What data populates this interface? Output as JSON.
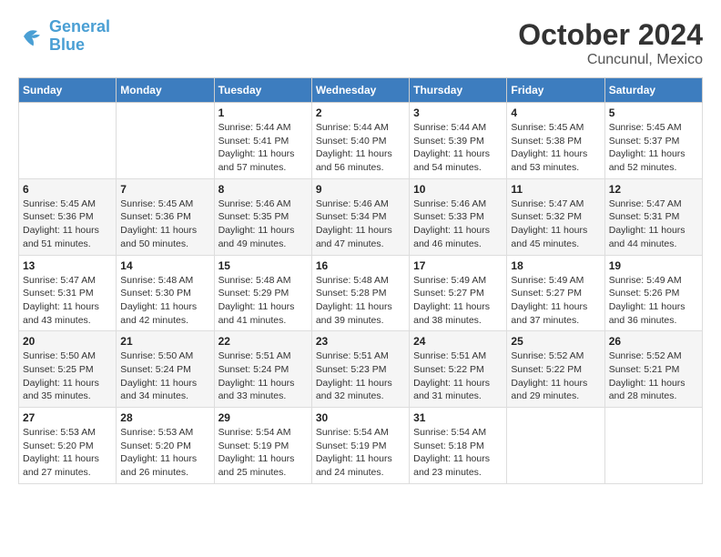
{
  "logo": {
    "line1": "General",
    "line2": "Blue"
  },
  "title": "October 2024",
  "location": "Cuncunul, Mexico",
  "weekdays": [
    "Sunday",
    "Monday",
    "Tuesday",
    "Wednesday",
    "Thursday",
    "Friday",
    "Saturday"
  ],
  "days": [
    {
      "num": "",
      "sunrise": "",
      "sunset": "",
      "daylight": ""
    },
    {
      "num": "",
      "sunrise": "",
      "sunset": "",
      "daylight": ""
    },
    {
      "num": "1",
      "sunrise": "Sunrise: 5:44 AM",
      "sunset": "Sunset: 5:41 PM",
      "daylight": "Daylight: 11 hours and 57 minutes."
    },
    {
      "num": "2",
      "sunrise": "Sunrise: 5:44 AM",
      "sunset": "Sunset: 5:40 PM",
      "daylight": "Daylight: 11 hours and 56 minutes."
    },
    {
      "num": "3",
      "sunrise": "Sunrise: 5:44 AM",
      "sunset": "Sunset: 5:39 PM",
      "daylight": "Daylight: 11 hours and 54 minutes."
    },
    {
      "num": "4",
      "sunrise": "Sunrise: 5:45 AM",
      "sunset": "Sunset: 5:38 PM",
      "daylight": "Daylight: 11 hours and 53 minutes."
    },
    {
      "num": "5",
      "sunrise": "Sunrise: 5:45 AM",
      "sunset": "Sunset: 5:37 PM",
      "daylight": "Daylight: 11 hours and 52 minutes."
    },
    {
      "num": "6",
      "sunrise": "Sunrise: 5:45 AM",
      "sunset": "Sunset: 5:36 PM",
      "daylight": "Daylight: 11 hours and 51 minutes."
    },
    {
      "num": "7",
      "sunrise": "Sunrise: 5:45 AM",
      "sunset": "Sunset: 5:36 PM",
      "daylight": "Daylight: 11 hours and 50 minutes."
    },
    {
      "num": "8",
      "sunrise": "Sunrise: 5:46 AM",
      "sunset": "Sunset: 5:35 PM",
      "daylight": "Daylight: 11 hours and 49 minutes."
    },
    {
      "num": "9",
      "sunrise": "Sunrise: 5:46 AM",
      "sunset": "Sunset: 5:34 PM",
      "daylight": "Daylight: 11 hours and 47 minutes."
    },
    {
      "num": "10",
      "sunrise": "Sunrise: 5:46 AM",
      "sunset": "Sunset: 5:33 PM",
      "daylight": "Daylight: 11 hours and 46 minutes."
    },
    {
      "num": "11",
      "sunrise": "Sunrise: 5:47 AM",
      "sunset": "Sunset: 5:32 PM",
      "daylight": "Daylight: 11 hours and 45 minutes."
    },
    {
      "num": "12",
      "sunrise": "Sunrise: 5:47 AM",
      "sunset": "Sunset: 5:31 PM",
      "daylight": "Daylight: 11 hours and 44 minutes."
    },
    {
      "num": "13",
      "sunrise": "Sunrise: 5:47 AM",
      "sunset": "Sunset: 5:31 PM",
      "daylight": "Daylight: 11 hours and 43 minutes."
    },
    {
      "num": "14",
      "sunrise": "Sunrise: 5:48 AM",
      "sunset": "Sunset: 5:30 PM",
      "daylight": "Daylight: 11 hours and 42 minutes."
    },
    {
      "num": "15",
      "sunrise": "Sunrise: 5:48 AM",
      "sunset": "Sunset: 5:29 PM",
      "daylight": "Daylight: 11 hours and 41 minutes."
    },
    {
      "num": "16",
      "sunrise": "Sunrise: 5:48 AM",
      "sunset": "Sunset: 5:28 PM",
      "daylight": "Daylight: 11 hours and 39 minutes."
    },
    {
      "num": "17",
      "sunrise": "Sunrise: 5:49 AM",
      "sunset": "Sunset: 5:27 PM",
      "daylight": "Daylight: 11 hours and 38 minutes."
    },
    {
      "num": "18",
      "sunrise": "Sunrise: 5:49 AM",
      "sunset": "Sunset: 5:27 PM",
      "daylight": "Daylight: 11 hours and 37 minutes."
    },
    {
      "num": "19",
      "sunrise": "Sunrise: 5:49 AM",
      "sunset": "Sunset: 5:26 PM",
      "daylight": "Daylight: 11 hours and 36 minutes."
    },
    {
      "num": "20",
      "sunrise": "Sunrise: 5:50 AM",
      "sunset": "Sunset: 5:25 PM",
      "daylight": "Daylight: 11 hours and 35 minutes."
    },
    {
      "num": "21",
      "sunrise": "Sunrise: 5:50 AM",
      "sunset": "Sunset: 5:24 PM",
      "daylight": "Daylight: 11 hours and 34 minutes."
    },
    {
      "num": "22",
      "sunrise": "Sunrise: 5:51 AM",
      "sunset": "Sunset: 5:24 PM",
      "daylight": "Daylight: 11 hours and 33 minutes."
    },
    {
      "num": "23",
      "sunrise": "Sunrise: 5:51 AM",
      "sunset": "Sunset: 5:23 PM",
      "daylight": "Daylight: 11 hours and 32 minutes."
    },
    {
      "num": "24",
      "sunrise": "Sunrise: 5:51 AM",
      "sunset": "Sunset: 5:22 PM",
      "daylight": "Daylight: 11 hours and 31 minutes."
    },
    {
      "num": "25",
      "sunrise": "Sunrise: 5:52 AM",
      "sunset": "Sunset: 5:22 PM",
      "daylight": "Daylight: 11 hours and 29 minutes."
    },
    {
      "num": "26",
      "sunrise": "Sunrise: 5:52 AM",
      "sunset": "Sunset: 5:21 PM",
      "daylight": "Daylight: 11 hours and 28 minutes."
    },
    {
      "num": "27",
      "sunrise": "Sunrise: 5:53 AM",
      "sunset": "Sunset: 5:20 PM",
      "daylight": "Daylight: 11 hours and 27 minutes."
    },
    {
      "num": "28",
      "sunrise": "Sunrise: 5:53 AM",
      "sunset": "Sunset: 5:20 PM",
      "daylight": "Daylight: 11 hours and 26 minutes."
    },
    {
      "num": "29",
      "sunrise": "Sunrise: 5:54 AM",
      "sunset": "Sunset: 5:19 PM",
      "daylight": "Daylight: 11 hours and 25 minutes."
    },
    {
      "num": "30",
      "sunrise": "Sunrise: 5:54 AM",
      "sunset": "Sunset: 5:19 PM",
      "daylight": "Daylight: 11 hours and 24 minutes."
    },
    {
      "num": "31",
      "sunrise": "Sunrise: 5:54 AM",
      "sunset": "Sunset: 5:18 PM",
      "daylight": "Daylight: 11 hours and 23 minutes."
    },
    {
      "num": "",
      "sunrise": "",
      "sunset": "",
      "daylight": ""
    },
    {
      "num": "",
      "sunrise": "",
      "sunset": "",
      "daylight": ""
    }
  ]
}
